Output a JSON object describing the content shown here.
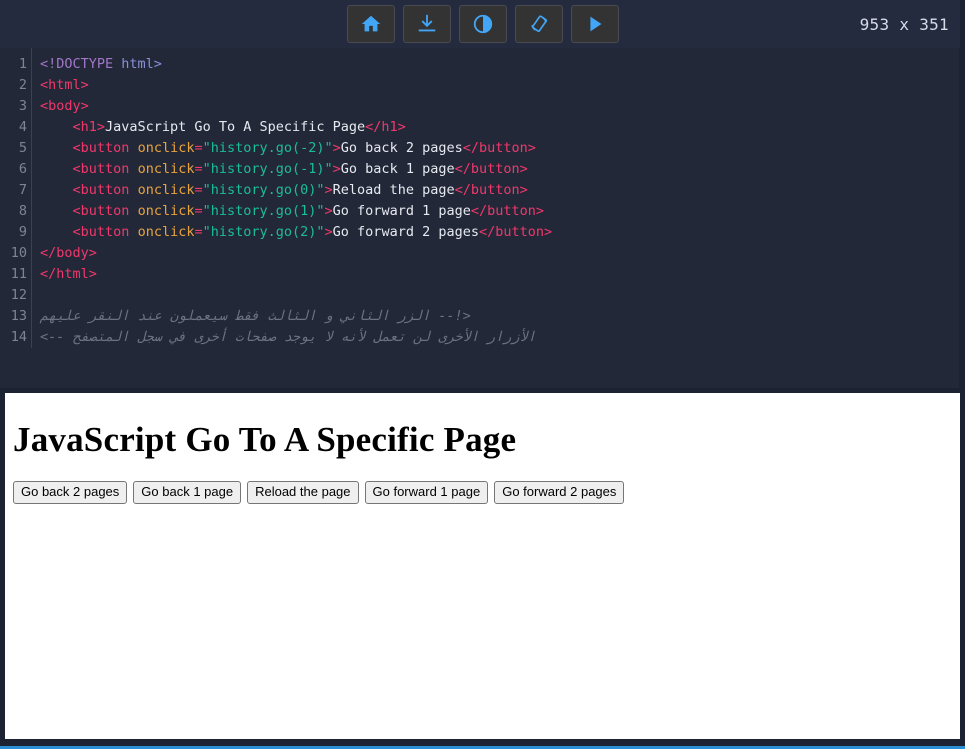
{
  "toolbar": {
    "buttons": [
      {
        "name": "home-button",
        "icon": "home-icon",
        "label": "Home"
      },
      {
        "name": "download-button",
        "icon": "download-icon",
        "label": "Download"
      },
      {
        "name": "theme-button",
        "icon": "contrast-icon",
        "label": "Toggle theme"
      },
      {
        "name": "rotate-button",
        "icon": "screen-rotation-icon",
        "label": "Rotate screen"
      },
      {
        "name": "run-button",
        "icon": "play-icon",
        "label": "Run"
      }
    ],
    "dimensions_label": "953 x 351",
    "accent_color": "#42a5f5",
    "button_bg": "#333333",
    "bar_bg": "#252b3f"
  },
  "editor": {
    "background": "#232838",
    "line_numbers": [
      "1",
      "2",
      "3",
      "4",
      "5",
      "6",
      "7",
      "8",
      "9",
      "10",
      "11",
      "12",
      "13",
      "14"
    ],
    "lines": [
      {
        "n": "1",
        "tokens": [
          {
            "c": "t-doctype",
            "t": "<!DOCTYPE "
          },
          {
            "c": "t-doctype2",
            "t": "html>"
          }
        ]
      },
      {
        "n": "2",
        "tokens": [
          {
            "c": "t-tag",
            "t": "<html>"
          }
        ]
      },
      {
        "n": "3",
        "tokens": [
          {
            "c": "t-tag",
            "t": "<body>"
          }
        ]
      },
      {
        "n": "4",
        "tokens": [
          {
            "c": "t-txt",
            "t": "    "
          },
          {
            "c": "t-tag",
            "t": "<h1>"
          },
          {
            "c": "t-txt",
            "t": "JavaScript Go To A Specific Page"
          },
          {
            "c": "t-tag",
            "t": "</h1>"
          }
        ]
      },
      {
        "n": "5",
        "tokens": [
          {
            "c": "t-txt",
            "t": "    "
          },
          {
            "c": "t-tag",
            "t": "<button"
          },
          {
            "c": "t-txt",
            "t": " "
          },
          {
            "c": "t-attr",
            "t": "onclick"
          },
          {
            "c": "t-tag",
            "t": "="
          },
          {
            "c": "t-str",
            "t": "\"history.go(-2)\""
          },
          {
            "c": "t-tag",
            "t": ">"
          },
          {
            "c": "t-txt",
            "t": "Go back 2 pages"
          },
          {
            "c": "t-tag",
            "t": "</button>"
          }
        ]
      },
      {
        "n": "6",
        "tokens": [
          {
            "c": "t-txt",
            "t": "    "
          },
          {
            "c": "t-tag",
            "t": "<button"
          },
          {
            "c": "t-txt",
            "t": " "
          },
          {
            "c": "t-attr",
            "t": "onclick"
          },
          {
            "c": "t-tag",
            "t": "="
          },
          {
            "c": "t-str",
            "t": "\"history.go(-1)\""
          },
          {
            "c": "t-tag",
            "t": ">"
          },
          {
            "c": "t-txt",
            "t": "Go back 1 page"
          },
          {
            "c": "t-tag",
            "t": "</button>"
          }
        ]
      },
      {
        "n": "7",
        "tokens": [
          {
            "c": "t-txt",
            "t": "    "
          },
          {
            "c": "t-tag",
            "t": "<button"
          },
          {
            "c": "t-txt",
            "t": " "
          },
          {
            "c": "t-attr",
            "t": "onclick"
          },
          {
            "c": "t-tag",
            "t": "="
          },
          {
            "c": "t-str",
            "t": "\"history.go(0)\""
          },
          {
            "c": "t-tag",
            "t": ">"
          },
          {
            "c": "t-txt",
            "t": "Reload the page"
          },
          {
            "c": "t-tag",
            "t": "</button>"
          }
        ]
      },
      {
        "n": "8",
        "tokens": [
          {
            "c": "t-txt",
            "t": "    "
          },
          {
            "c": "t-tag",
            "t": "<button"
          },
          {
            "c": "t-txt",
            "t": " "
          },
          {
            "c": "t-attr",
            "t": "onclick"
          },
          {
            "c": "t-tag",
            "t": "="
          },
          {
            "c": "t-str",
            "t": "\"history.go(1)\""
          },
          {
            "c": "t-tag",
            "t": ">"
          },
          {
            "c": "t-txt",
            "t": "Go forward 1 page"
          },
          {
            "c": "t-tag",
            "t": "</button>"
          }
        ]
      },
      {
        "n": "9",
        "tokens": [
          {
            "c": "t-txt",
            "t": "    "
          },
          {
            "c": "t-tag",
            "t": "<button"
          },
          {
            "c": "t-txt",
            "t": " "
          },
          {
            "c": "t-attr",
            "t": "onclick"
          },
          {
            "c": "t-tag",
            "t": "="
          },
          {
            "c": "t-str",
            "t": "\"history.go(2)\""
          },
          {
            "c": "t-tag",
            "t": ">"
          },
          {
            "c": "t-txt",
            "t": "Go forward 2 pages"
          },
          {
            "c": "t-tag",
            "t": "</button>"
          }
        ]
      },
      {
        "n": "10",
        "tokens": [
          {
            "c": "t-tag",
            "t": "</body>"
          }
        ]
      },
      {
        "n": "11",
        "tokens": [
          {
            "c": "t-tag",
            "t": "</html>"
          }
        ]
      },
      {
        "n": "12",
        "tokens": []
      },
      {
        "n": "13",
        "tokens": [
          {
            "c": "t-comment",
            "t": "<!-- الزر الثاني و الثالث فقط سيعملون عند النقر عليهم"
          }
        ]
      },
      {
        "n": "14",
        "tokens": [
          {
            "c": "t-comment",
            "t": "الأزرار الأخرى لن تعمل لأنه لا يوجد صفحات أخرى في سجل المتصفح -->"
          }
        ]
      }
    ]
  },
  "preview": {
    "heading": "JavaScript Go To A Specific Page",
    "buttons": [
      "Go back 2 pages",
      "Go back 1 page",
      "Reload the page",
      "Go forward 1 page",
      "Go forward 2 pages"
    ],
    "background": "#ffffff"
  },
  "chrome": {
    "page_background": "#1d2233",
    "bottom_accent_color": "#2b8fd8"
  }
}
